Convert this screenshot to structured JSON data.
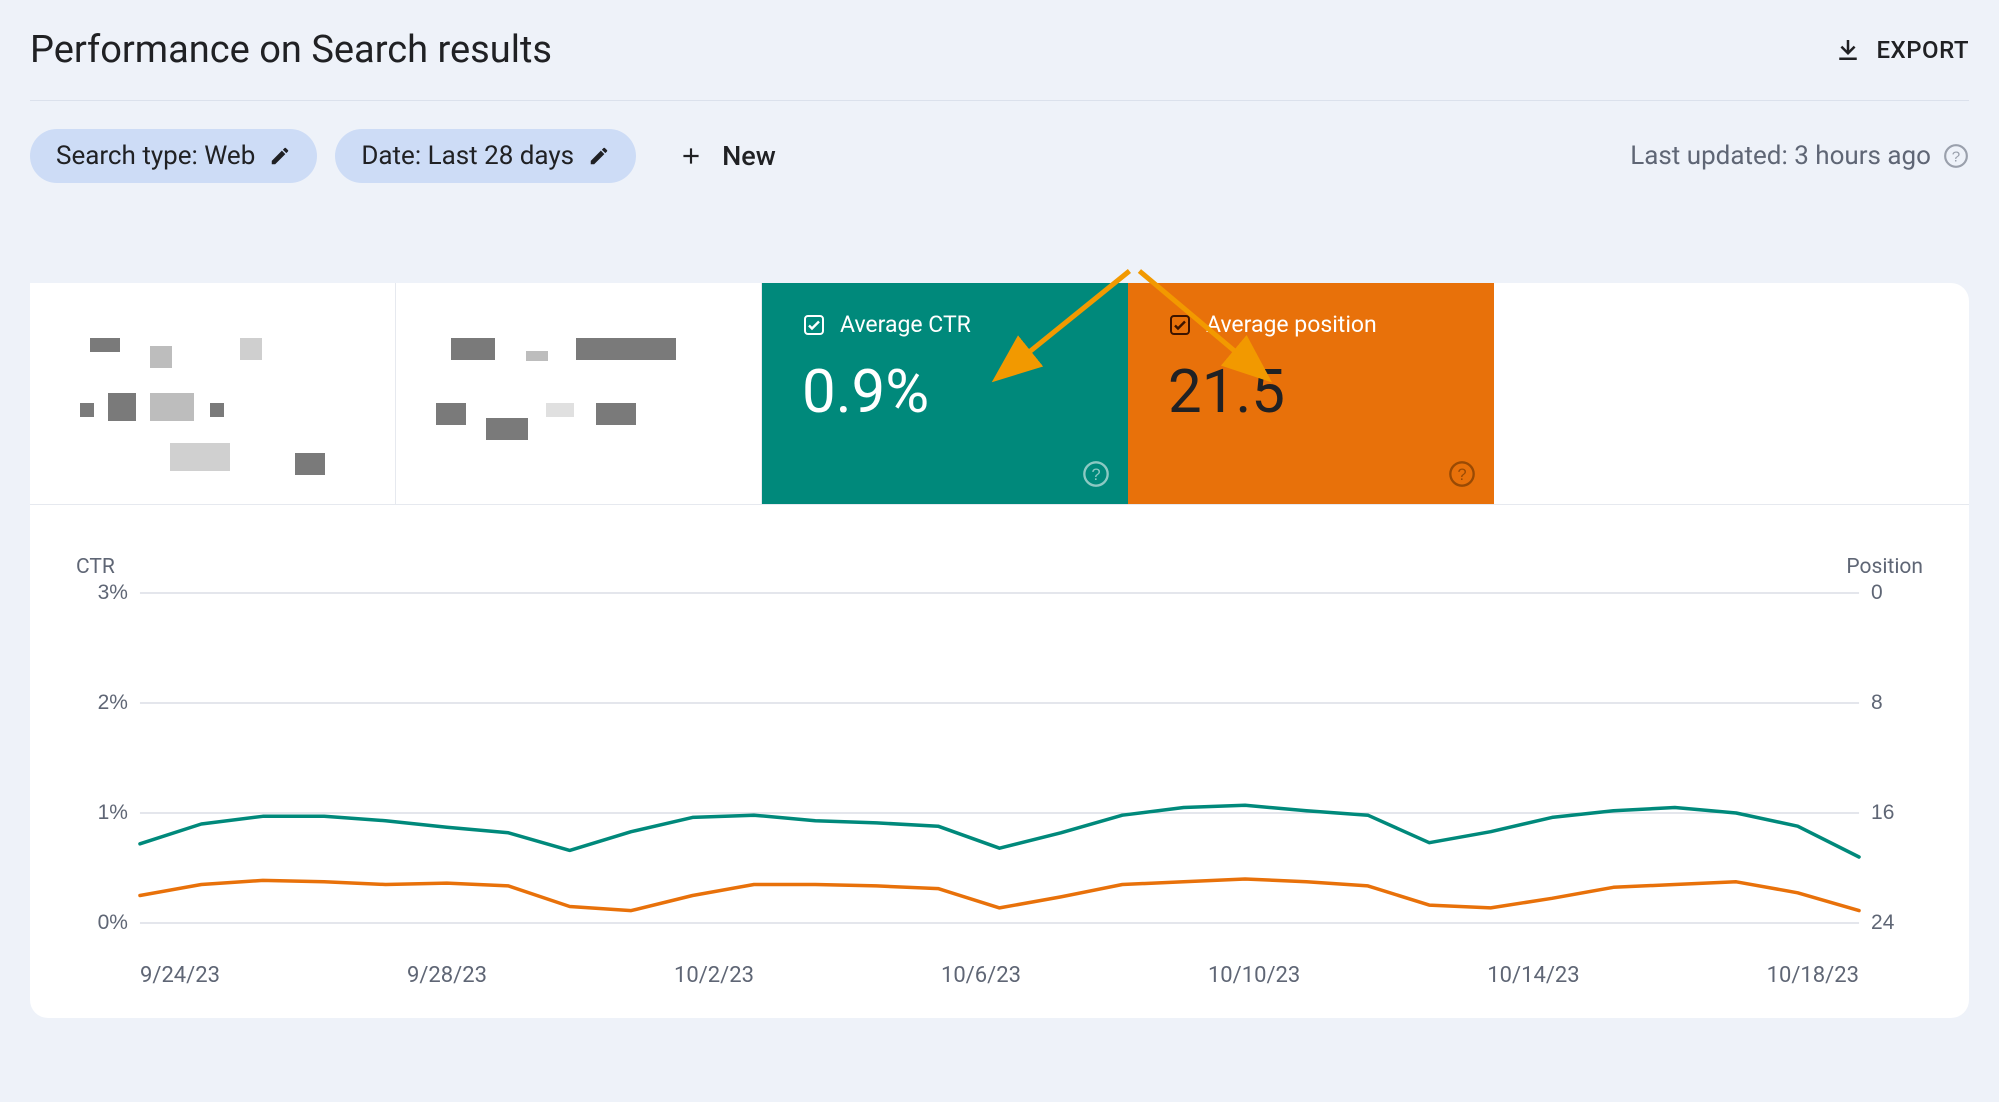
{
  "header": {
    "title": "Performance on Search results",
    "export_label": "EXPORT"
  },
  "filters": {
    "search_type": "Search type: Web",
    "date_range": "Date: Last 28 days",
    "new_label": "New",
    "last_updated": "Last updated: 3 hours ago"
  },
  "tiles": {
    "ctr": {
      "label": "Average CTR",
      "value": "0.9%",
      "color": "#00897b"
    },
    "position": {
      "label": "Average position",
      "value": "21.5",
      "color": "#e8710a"
    }
  },
  "chart_data": {
    "type": "line",
    "title": "",
    "xlabel": "",
    "y_left": {
      "label": "CTR",
      "ticks": [
        "3%",
        "2%",
        "1%",
        "0%"
      ],
      "range": [
        0,
        3
      ]
    },
    "y_right": {
      "label": "Position",
      "ticks": [
        0,
        8,
        16,
        24
      ],
      "range": [
        24,
        0
      ]
    },
    "x_ticks": [
      "9/24/23",
      "9/28/23",
      "10/2/23",
      "10/6/23",
      "10/10/23",
      "10/14/23",
      "10/18/23"
    ],
    "series": [
      {
        "name": "Average CTR",
        "axis": "left",
        "color": "#00897b",
        "unit": "%",
        "values": [
          0.72,
          0.9,
          0.97,
          0.97,
          0.93,
          0.87,
          0.82,
          0.66,
          0.83,
          0.96,
          0.98,
          0.93,
          0.91,
          0.88,
          0.68,
          0.82,
          0.98,
          1.05,
          1.07,
          1.02,
          0.98,
          0.73,
          0.83,
          0.96,
          1.02,
          1.05,
          1.0,
          0.88,
          0.6
        ]
      },
      {
        "name": "Average position",
        "axis": "right",
        "color": "#e8710a",
        "values": [
          22.0,
          21.2,
          20.9,
          21.0,
          21.2,
          21.1,
          21.3,
          22.8,
          23.1,
          22.0,
          21.2,
          21.2,
          21.3,
          21.5,
          22.9,
          22.1,
          21.2,
          21.0,
          20.8,
          21.0,
          21.3,
          22.7,
          22.9,
          22.2,
          21.4,
          21.2,
          21.0,
          21.8,
          23.1
        ]
      }
    ]
  }
}
